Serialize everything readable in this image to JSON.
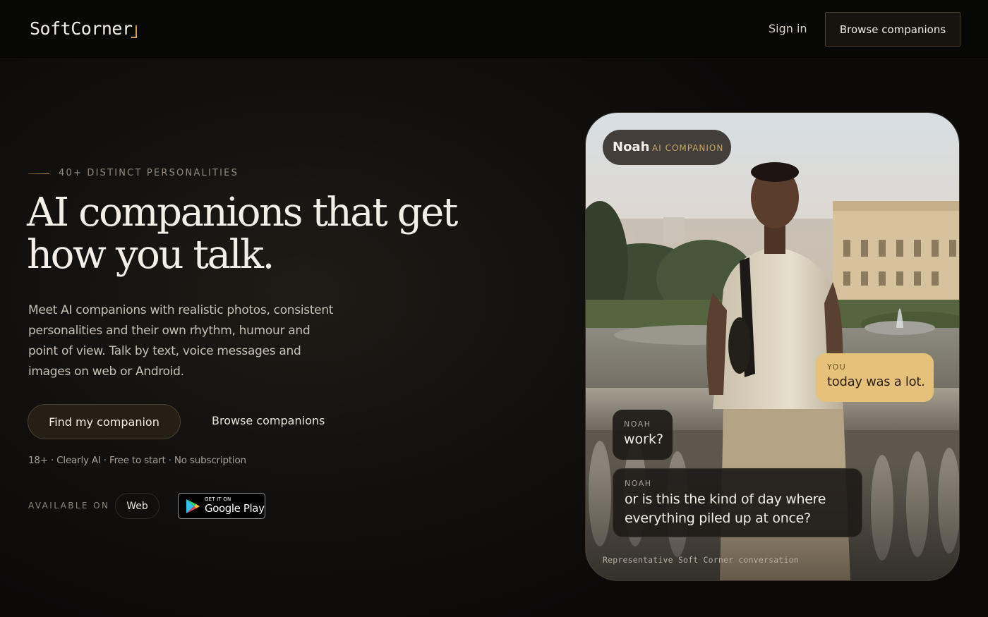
{
  "header": {
    "logo": "SoftCorner",
    "sign_in": "Sign in",
    "browse": "Browse companions"
  },
  "hero": {
    "eyebrow": "40+ DISTINCT PERSONALITIES",
    "headline_line1": "AI companions that get",
    "headline_line2": "how you talk.",
    "lede": "Meet AI companions with realistic photos, consistent personalities and their own rhythm, humour and point of view. Talk by text, voice messages and images on web or Android.",
    "cta_primary": "Find my companion",
    "cta_secondary": "Browse companions",
    "fineprint": "18+ · Clearly AI · Free to start · No subscription",
    "available_on": "AVAILABLE ON",
    "platform_web": "Web",
    "gplay_small": "GET IT ON",
    "gplay_big": "Google Play"
  },
  "preview": {
    "name": "Noah",
    "role": "AI COMPANION",
    "messages": [
      {
        "sender": "YOU",
        "text": "today was a lot."
      },
      {
        "sender": "NOAH",
        "text": "work?"
      },
      {
        "sender": "NOAH",
        "text": "or is this the kind of day where everything piled up at once?"
      }
    ],
    "caption": "Representative Soft Corner conversation"
  },
  "colors": {
    "accent_gold": "#c9a05a",
    "you_bubble": "#e6c17a",
    "background": "#0a0908"
  }
}
